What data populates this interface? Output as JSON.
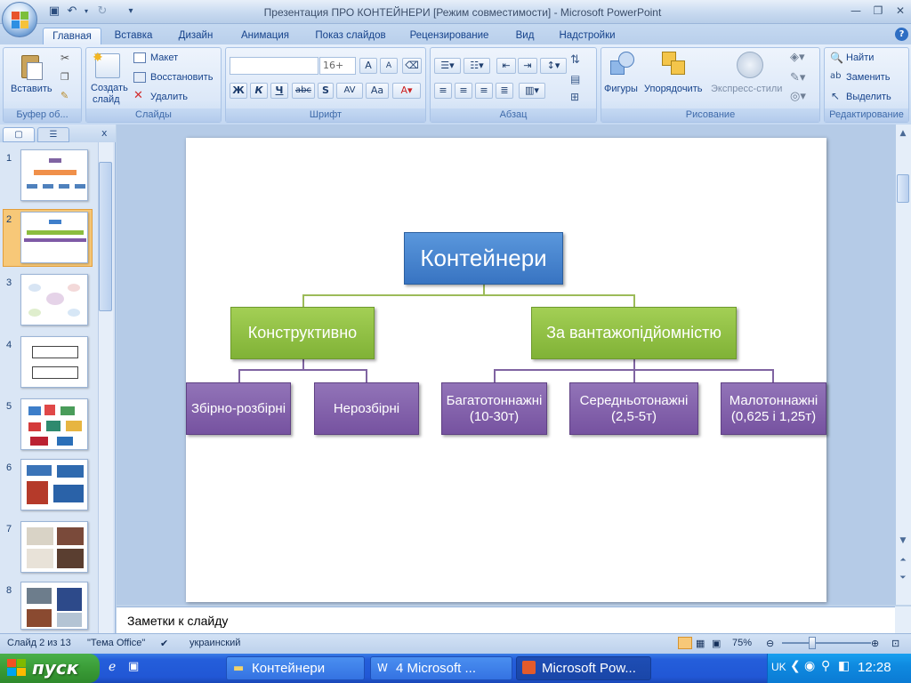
{
  "window": {
    "title": "Презентация ПРО КОНТЕЙНЕРИ [Режим совместимости] - Microsoft PowerPoint"
  },
  "tabs": [
    "Главная",
    "Вставка",
    "Дизайн",
    "Анимация",
    "Показ слайдов",
    "Рецензирование",
    "Вид",
    "Надстройки"
  ],
  "ribbon": {
    "clipboard": {
      "label": "Буфер об...",
      "paste": "Вставить"
    },
    "slides": {
      "label": "Слайды",
      "new_slide_1": "Создать",
      "new_slide_2": "слайд",
      "layout": "Макет",
      "reset": "Восстановить",
      "delete": "Удалить"
    },
    "font": {
      "label": "Шрифт",
      "font_name": "",
      "font_size": "16+",
      "bold": "Ж",
      "italic": "К",
      "underline": "Ч",
      "strike": "abc",
      "shadow": "S",
      "spacing": "AV",
      "case": "Aa",
      "grow": "A",
      "shrink": "A"
    },
    "paragraph": {
      "label": "Абзац"
    },
    "drawing": {
      "label": "Рисование",
      "shapes": "Фигуры",
      "arrange": "Упорядочить",
      "quick_styles": "Экспресс-стили"
    },
    "editing": {
      "label": "Редактирование",
      "find": "Найти",
      "replace": "Заменить",
      "select": "Выделить"
    }
  },
  "slide_panel": {
    "close": "x",
    "thumbnails": [
      {
        "num": "1"
      },
      {
        "num": "2"
      },
      {
        "num": "3"
      },
      {
        "num": "4"
      },
      {
        "num": "5"
      },
      {
        "num": "6"
      },
      {
        "num": "7"
      },
      {
        "num": "8"
      }
    ]
  },
  "slide": {
    "root": "Контейнери",
    "left": "Конструктивно",
    "right": "За вантажопідйомністю",
    "left_children": [
      "Збірно-розбірні",
      "Нерозбірні"
    ],
    "right_children": [
      "Багатотоннажні\n(10-30т)",
      "Середньотонажні\n(2,5-5т)",
      "Малотоннажні\n(0,625 і 1,25т)"
    ],
    "colors": {
      "blue": "#3f7fcb",
      "green": "#8bbd3f",
      "purple": "#7e5aa6"
    }
  },
  "notes": {
    "text": "Заметки к слайду"
  },
  "status": {
    "slide": "Слайд 2 из 13",
    "theme": "\"Тема Office\"",
    "language": "украинский",
    "zoom": "75%"
  },
  "taskbar": {
    "start": "пуск",
    "tasks": [
      "Контейнери",
      "4 Microsoft ...",
      "Microsoft Pow..."
    ],
    "lang": "UK",
    "time": "12:28"
  }
}
